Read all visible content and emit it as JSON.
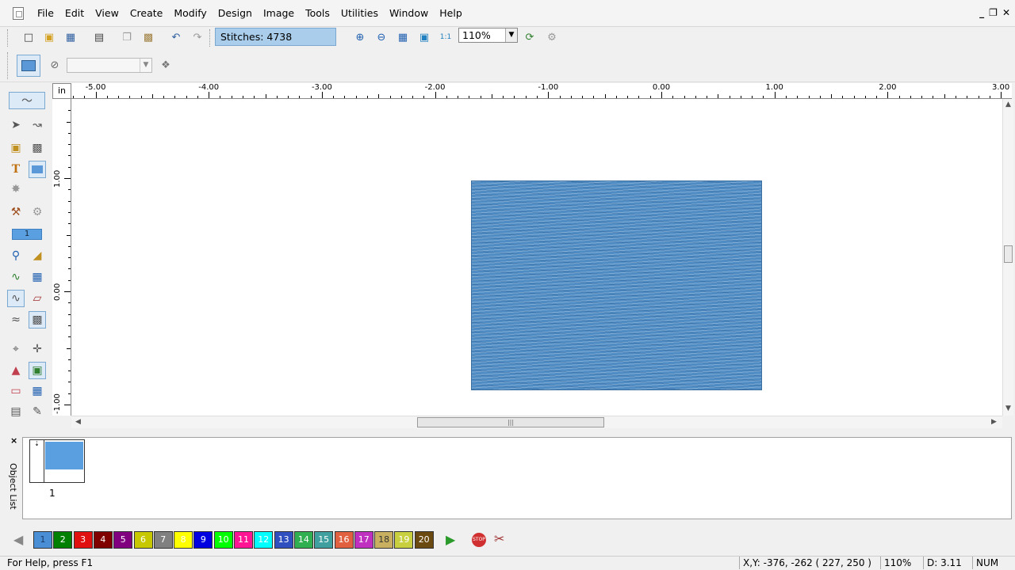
{
  "menu": {
    "items": [
      "File",
      "Edit",
      "View",
      "Create",
      "Modify",
      "Design",
      "Image",
      "Tools",
      "Utilities",
      "Window",
      "Help"
    ]
  },
  "window_controls": [
    "_",
    "❐",
    "✕"
  ],
  "toolbar": {
    "stitches_label": "Stitches: 4738",
    "zoom": "110%",
    "icons": [
      "new-file-icon",
      "open-folder-icon",
      "save-icon",
      "print-icon",
      "copy-icon",
      "paste-icon",
      "undo-icon",
      "redo-icon",
      "zoom-in-icon",
      "zoom-out-icon",
      "zoom-to-fit-icon",
      "zoom-extents-icon",
      "zoom-1-1-icon",
      "redraw-icon",
      "slow-redraw-icon"
    ]
  },
  "toolbar2": {
    "thread_value": "",
    "icons": [
      "fill-shape-icon",
      "no-entry-icon",
      "thread-chart-icon"
    ]
  },
  "palette": {
    "current_color_label": "1",
    "icons": [
      "digitize-icon",
      "select-arrow-icon",
      "reshape-icon",
      "shape-fill-icon",
      "auto-digitize-icon",
      "text-icon",
      "shape-icon",
      "magic-wand-icon",
      "hammer-icon",
      "gears-icon",
      "zoom-icon",
      "ruler-icon",
      "stitch-icon-a",
      "stitch-icon-b",
      "run-stitch-icon",
      "satin-stitch-icon",
      "fill-stitch-icon",
      "motif-icon",
      "crop-icon",
      "move-icon",
      "eraser-icon",
      "frame-icon",
      "rectangle-icon",
      "grid-icon",
      "picture-icon",
      "edit-picture-icon"
    ]
  },
  "ruler": {
    "unit": "in",
    "h_labels": [
      "-5.00",
      "-4.00",
      "-3.00",
      "-2.00",
      "-1.00",
      "0.00",
      "1.00",
      "2.00",
      "3.00"
    ],
    "v_labels": [
      "1.00",
      "0.00",
      "-1.00"
    ]
  },
  "object_list": {
    "title": "Object List",
    "close": "×",
    "items": [
      {
        "label": "1",
        "color": "#5aa0e0"
      }
    ]
  },
  "colors": [
    {
      "label": "1",
      "hex": "#4a8fd6",
      "text": "#1a3a66"
    },
    {
      "label": "2",
      "hex": "#008000",
      "text": "#ffffff"
    },
    {
      "label": "3",
      "hex": "#e01010",
      "text": "#ffffff"
    },
    {
      "label": "4",
      "hex": "#800000",
      "text": "#ffffff"
    },
    {
      "label": "5",
      "hex": "#800080",
      "text": "#ffffff"
    },
    {
      "label": "6",
      "hex": "#c8c800",
      "text": "#ffffff"
    },
    {
      "label": "7",
      "hex": "#808080",
      "text": "#ffffff"
    },
    {
      "label": "8",
      "hex": "#ffff00",
      "text": "#ffffff"
    },
    {
      "label": "9",
      "hex": "#0000e0",
      "text": "#ffffff"
    },
    {
      "label": "10",
      "hex": "#00ff00",
      "text": "#ffffff"
    },
    {
      "label": "11",
      "hex": "#ff1493",
      "text": "#ffffff"
    },
    {
      "label": "12",
      "hex": "#00ffff",
      "text": "#ffffff"
    },
    {
      "label": "13",
      "hex": "#3050c0",
      "text": "#ffffff"
    },
    {
      "label": "14",
      "hex": "#30b050",
      "text": "#ffffff"
    },
    {
      "label": "15",
      "hex": "#40a0a0",
      "text": "#ffffff"
    },
    {
      "label": "16",
      "hex": "#e06040",
      "text": "#ffffff"
    },
    {
      "label": "17",
      "hex": "#c030c0",
      "text": "#ffffff"
    },
    {
      "label": "18",
      "hex": "#c8b060",
      "text": "#333333"
    },
    {
      "label": "19",
      "hex": "#c8d040",
      "text": "#ffffff"
    },
    {
      "label": "20",
      "hex": "#6a4a10",
      "text": "#ffffff"
    }
  ],
  "status": {
    "help": "For Help, press F1",
    "coords": "X,Y: -376, -262  ( 227, 250 )",
    "zoom": "110%",
    "density": "D: 3.11",
    "num": "NUM"
  },
  "accent_colors": {
    "selection": "#a9cdea",
    "design_fill": "#4f8cc4"
  }
}
